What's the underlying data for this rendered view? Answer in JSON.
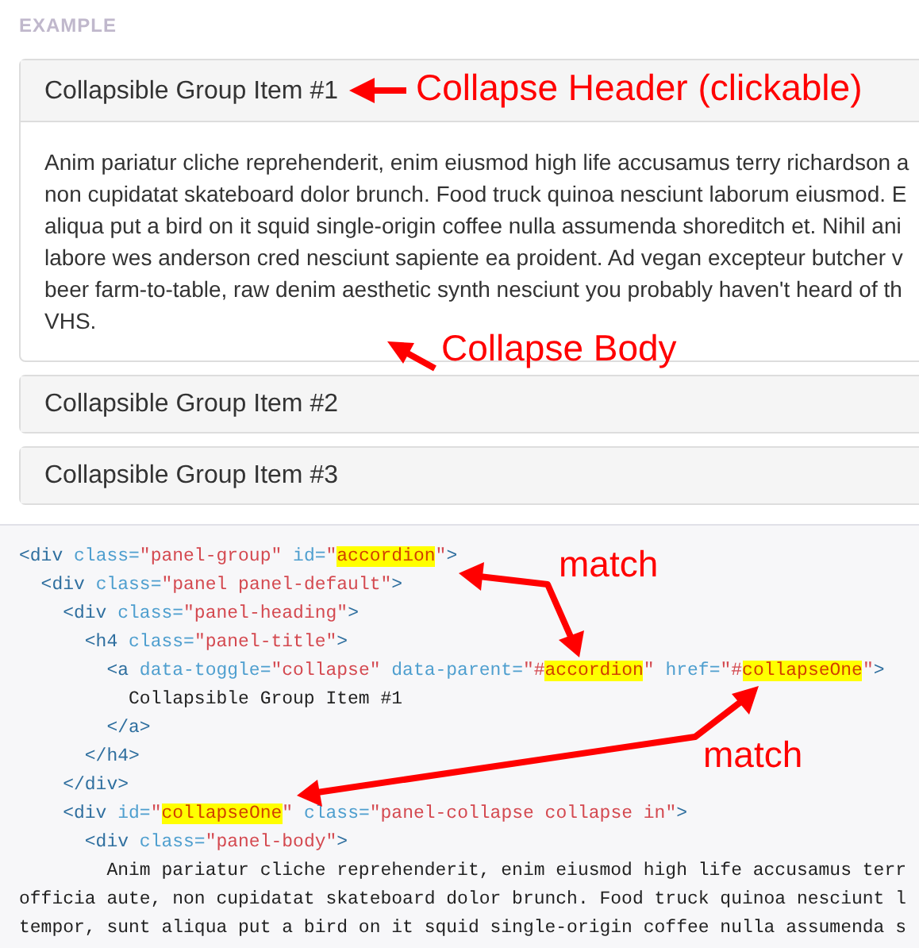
{
  "example_label": "EXAMPLE",
  "panels": [
    {
      "title": "Collapsible Group Item #1",
      "expanded": true,
      "body_lines": [
        "Anim pariatur cliche reprehenderit, enim eiusmod high life accusamus terry richardson a",
        "non cupidatat skateboard dolor brunch. Food truck quinoa nesciunt laborum eiusmod. E",
        "aliqua put a bird on it squid single-origin coffee nulla assumenda shoreditch et. Nihil ani",
        "labore wes anderson cred nesciunt sapiente ea proident. Ad vegan excepteur butcher v",
        "beer farm-to-table, raw denim aesthetic synth nesciunt you probably haven't heard of th",
        "VHS."
      ]
    },
    {
      "title": "Collapsible Group Item #2",
      "expanded": false
    },
    {
      "title": "Collapsible Group Item #3",
      "expanded": false
    }
  ],
  "code_lines": [
    [
      {
        "text": "<div",
        "kind": "tag"
      },
      {
        "text": " class=",
        "kind": "attr"
      },
      {
        "text": "\"panel-group\"",
        "kind": "value"
      },
      {
        "text": " id=",
        "kind": "attr"
      },
      {
        "text": "\"",
        "kind": "value"
      },
      {
        "text": "accordion",
        "kind": "mark"
      },
      {
        "text": "\"",
        "kind": "value"
      },
      {
        "text": ">",
        "kind": "tag"
      }
    ],
    [
      {
        "text": "  <div",
        "kind": "tag"
      },
      {
        "text": " class=",
        "kind": "attr"
      },
      {
        "text": "\"panel panel-default\"",
        "kind": "value"
      },
      {
        "text": ">",
        "kind": "tag"
      }
    ],
    [
      {
        "text": "    <div",
        "kind": "tag"
      },
      {
        "text": " class=",
        "kind": "attr"
      },
      {
        "text": "\"panel-heading\"",
        "kind": "value"
      },
      {
        "text": ">",
        "kind": "tag"
      }
    ],
    [
      {
        "text": "      <h4",
        "kind": "tag"
      },
      {
        "text": " class=",
        "kind": "attr"
      },
      {
        "text": "\"panel-title\"",
        "kind": "value"
      },
      {
        "text": ">",
        "kind": "tag"
      }
    ],
    [
      {
        "text": "        <a",
        "kind": "tag"
      },
      {
        "text": " data-toggle=",
        "kind": "attr"
      },
      {
        "text": "\"collapse\"",
        "kind": "value"
      },
      {
        "text": " data-parent=",
        "kind": "attr"
      },
      {
        "text": "\"#",
        "kind": "value"
      },
      {
        "text": "accordion",
        "kind": "mark"
      },
      {
        "text": "\"",
        "kind": "value"
      },
      {
        "text": " href=",
        "kind": "attr"
      },
      {
        "text": "\"#",
        "kind": "value"
      },
      {
        "text": "collapseOne",
        "kind": "mark"
      },
      {
        "text": "\"",
        "kind": "value"
      },
      {
        "text": ">",
        "kind": "tag"
      }
    ],
    [
      {
        "text": "          Collapsible Group Item #1",
        "kind": "text"
      }
    ],
    [
      {
        "text": "        </a>",
        "kind": "tag"
      }
    ],
    [
      {
        "text": "      </h4>",
        "kind": "tag"
      }
    ],
    [
      {
        "text": "    </div>",
        "kind": "tag"
      }
    ],
    [
      {
        "text": "    <div",
        "kind": "tag"
      },
      {
        "text": " id=",
        "kind": "attr"
      },
      {
        "text": "\"",
        "kind": "value"
      },
      {
        "text": "collapseOne",
        "kind": "mark"
      },
      {
        "text": "\"",
        "kind": "value"
      },
      {
        "text": " class=",
        "kind": "attr"
      },
      {
        "text": "\"panel-collapse collapse in\"",
        "kind": "value"
      },
      {
        "text": ">",
        "kind": "tag"
      }
    ],
    [
      {
        "text": "      <div",
        "kind": "tag"
      },
      {
        "text": " class=",
        "kind": "attr"
      },
      {
        "text": "\"panel-body\"",
        "kind": "value"
      },
      {
        "text": ">",
        "kind": "tag"
      }
    ],
    [
      {
        "text": "        Anim pariatur cliche reprehenderit, enim eiusmod high life accusamus terr",
        "kind": "text"
      }
    ],
    [
      {
        "text": "officia aute, non cupidatat skateboard dolor brunch. Food truck quinoa nesciunt l",
        "kind": "text"
      }
    ],
    [
      {
        "text": "tempor, sunt aliqua put a bird on it squid single-origin coffee nulla assumenda s",
        "kind": "text"
      }
    ]
  ],
  "annotations": {
    "header_note": "Collapse Header (clickable)",
    "body_note": "Collapse Body",
    "match_notes": [
      "match",
      "match"
    ]
  }
}
